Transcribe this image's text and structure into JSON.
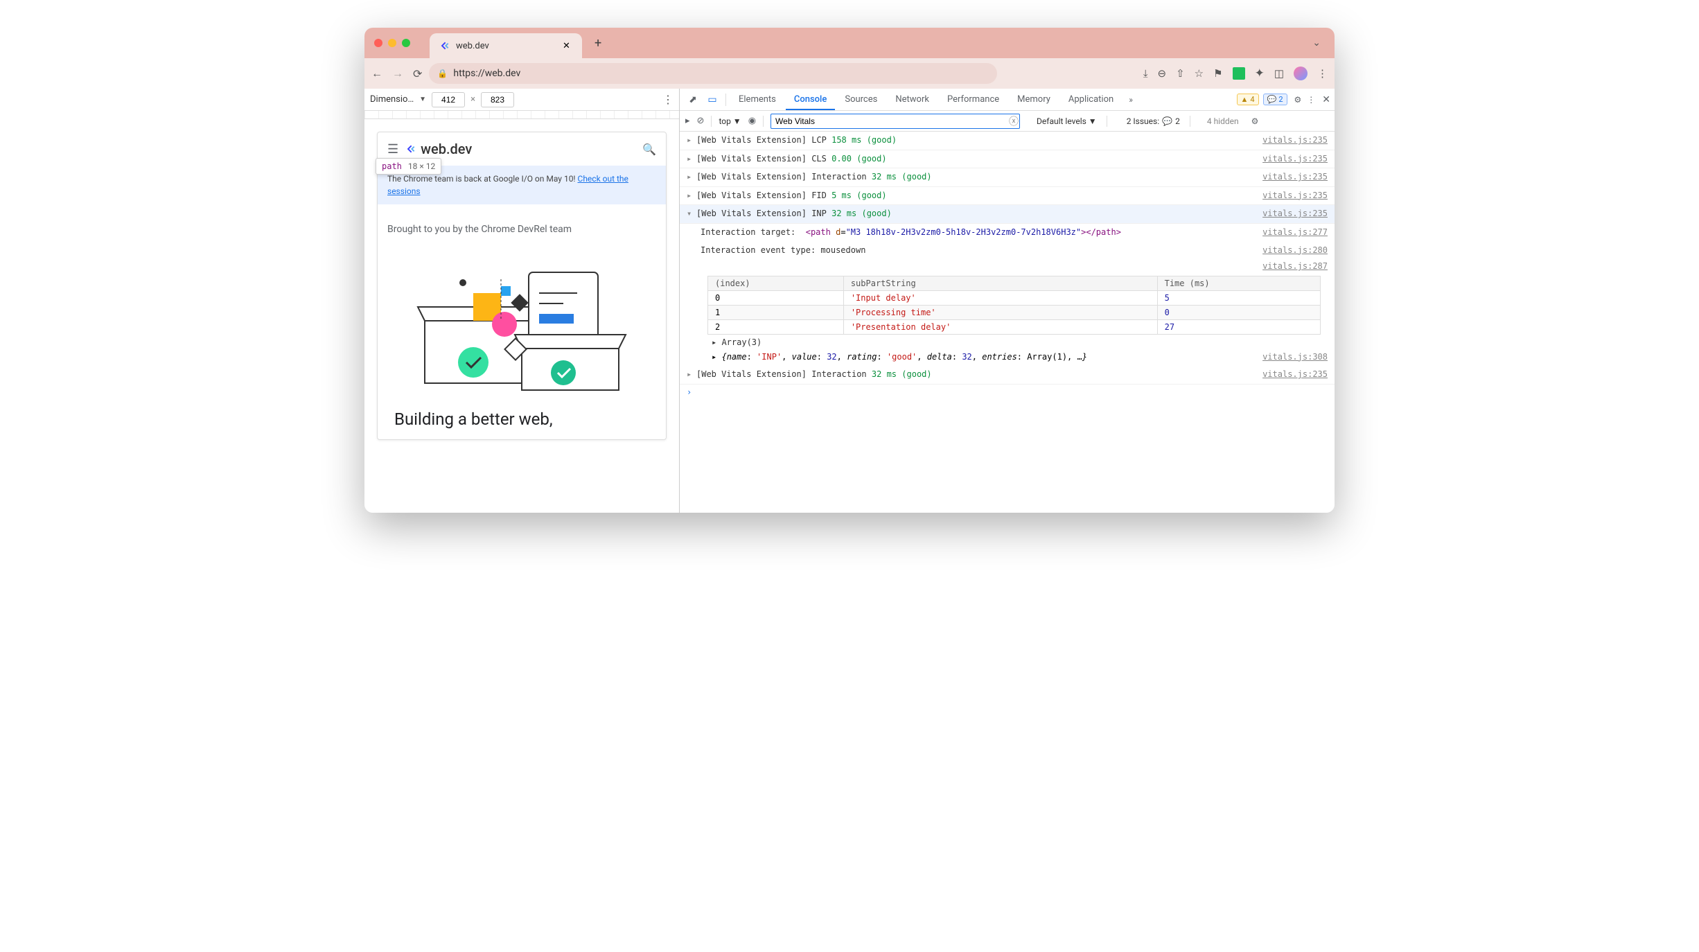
{
  "browser": {
    "tab_title": "web.dev",
    "url": "https://web.dev",
    "new_tab": "+",
    "dropdown": "⌄"
  },
  "device_toolbar": {
    "label": "Dimensio…",
    "width": "412",
    "height": "823",
    "x": "×",
    "menu": "⋮"
  },
  "tooltip": {
    "element": "path",
    "dims": "18 × 12"
  },
  "site": {
    "brand": "web.dev",
    "banner_text": "The Chrome team is back at Google I/O on May 10! ",
    "banner_link": "Check out the sessions",
    "subhead": "Brought to you by the Chrome DevRel team",
    "headline": "Building a better web,"
  },
  "devtools": {
    "tabs": [
      "Elements",
      "Console",
      "Sources",
      "Network",
      "Performance",
      "Memory",
      "Application"
    ],
    "active_tab": "Console",
    "more": "»",
    "warn_count": "4",
    "info_count": "2",
    "filter": {
      "context": "top",
      "value": "Web Vitals",
      "levels": "Default levels",
      "issues_label": "2 Issues:",
      "issues_count": "2",
      "hidden": "4 hidden"
    },
    "logs": [
      {
        "expanded": false,
        "prefix": "[Web Vitals Extension]",
        "metric": "LCP",
        "value": "158 ms",
        "rating": "(good)",
        "src": "vitals.js:235"
      },
      {
        "expanded": false,
        "prefix": "[Web Vitals Extension]",
        "metric": "CLS",
        "value": "0.00",
        "rating": "(good)",
        "src": "vitals.js:235"
      },
      {
        "expanded": false,
        "prefix": "[Web Vitals Extension]",
        "metric": "Interaction",
        "value": "32 ms",
        "rating": "(good)",
        "src": "vitals.js:235"
      },
      {
        "expanded": false,
        "prefix": "[Web Vitals Extension]",
        "metric": "FID",
        "value": "5 ms",
        "rating": "(good)",
        "src": "vitals.js:235"
      },
      {
        "expanded": true,
        "prefix": "[Web Vitals Extension]",
        "metric": "INP",
        "value": "32 ms",
        "rating": "(good)",
        "src": "vitals.js:235"
      }
    ],
    "interaction_target_label": "Interaction target:",
    "interaction_target_src": "vitals.js:277",
    "interaction_target_tag": "<path",
    "interaction_target_attr": "d",
    "interaction_target_val": "\"M3 18h18v-2H3v2zm0-5h18v-2H3v2zm0-7v2h18V6H3z\"",
    "interaction_target_close": "></path>",
    "interaction_event_label": "Interaction event type:",
    "interaction_event_value": "mousedown",
    "interaction_event_src": "vitals.js:280",
    "table_src": "vitals.js:287",
    "table": {
      "headers": [
        "(index)",
        "subPartString",
        "Time (ms)"
      ],
      "rows": [
        {
          "index": "0",
          "sub": "'Input delay'",
          "time": "5"
        },
        {
          "index": "1",
          "sub": "'Processing time'",
          "time": "0"
        },
        {
          "index": "2",
          "sub": "'Presentation delay'",
          "time": "27"
        }
      ]
    },
    "array_label": "Array(3)",
    "object_text": "{name: 'INP', value: 32, rating: 'good', delta: 32, entries: Array(1), …}",
    "object_src": "vitals.js:308",
    "final_log": {
      "prefix": "[Web Vitals Extension]",
      "metric": "Interaction",
      "value": "32 ms",
      "rating": "(good)",
      "src": "vitals.js:235"
    }
  }
}
